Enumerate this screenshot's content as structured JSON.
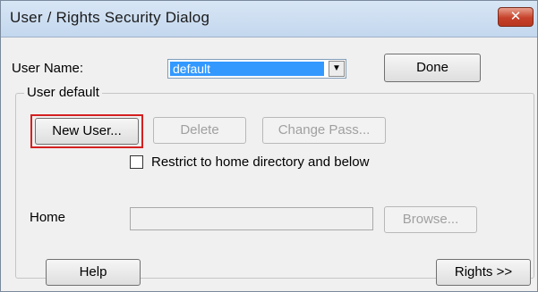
{
  "window": {
    "title": "User / Rights Security Dialog",
    "close_glyph": "✕"
  },
  "user": {
    "label": "User Name:",
    "selected": "default",
    "dropdown_glyph": "▼"
  },
  "buttons": {
    "done": "Done",
    "new_user": "New User...",
    "delete": "Delete",
    "change_pass": "Change Pass...",
    "browse": "Browse...",
    "help": "Help",
    "rights": "Rights >>"
  },
  "group": {
    "title": "User default",
    "restrict_label": "Restrict to home directory and below",
    "restrict_checked": false,
    "home_label": "Home",
    "home_value": ""
  },
  "colors": {
    "selection": "#3399ff",
    "highlight_box": "#d42020",
    "close_button": "#c6412a"
  }
}
